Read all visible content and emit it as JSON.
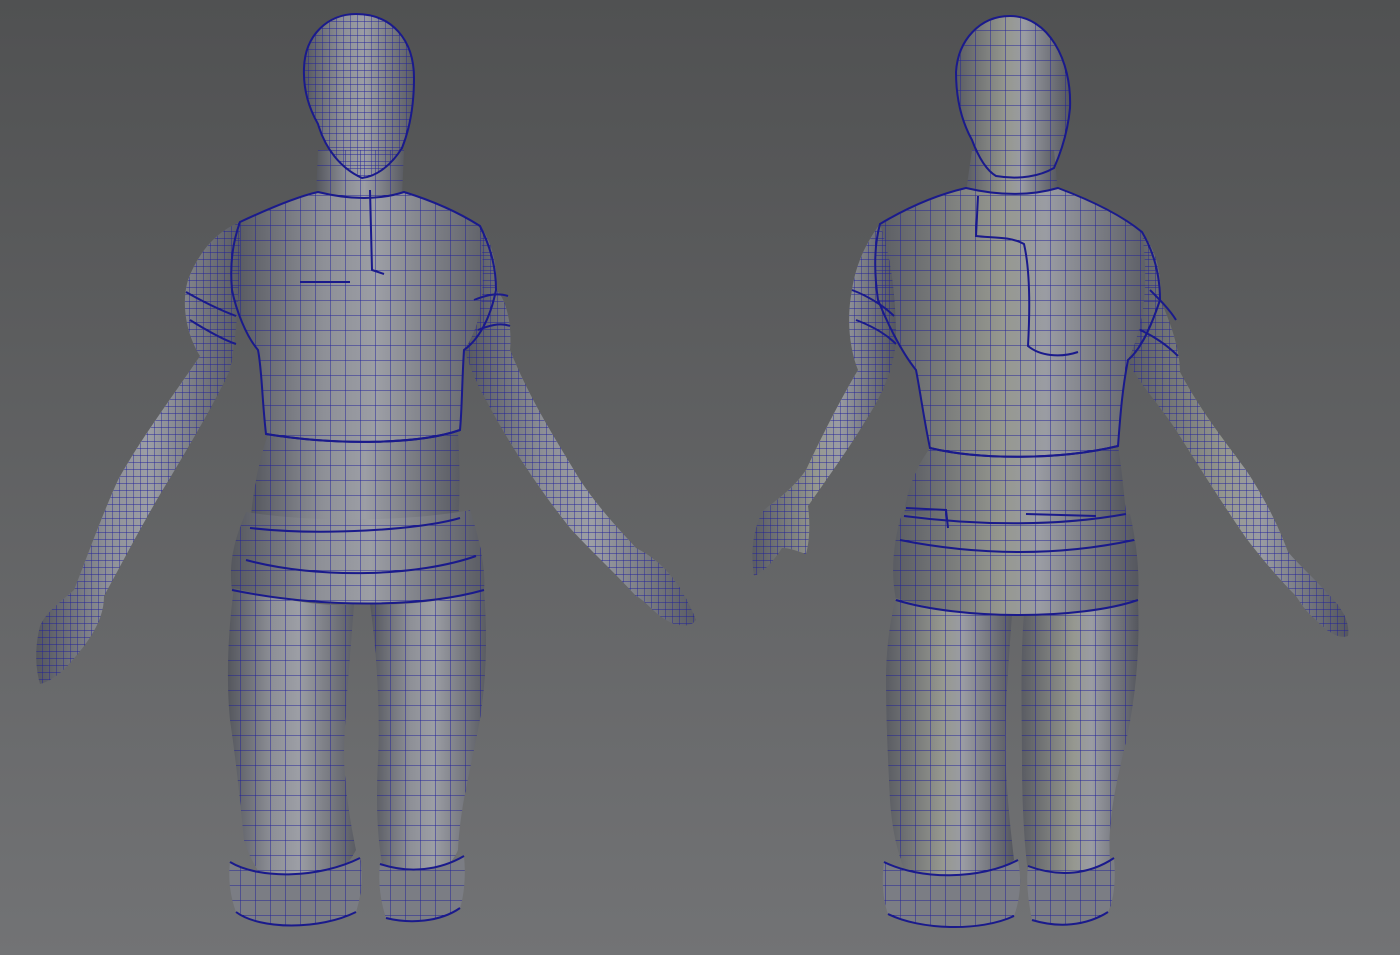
{
  "viewport": {
    "background_top": "#505152",
    "background_bottom": "#727375"
  },
  "models": [
    {
      "id": "front",
      "view": "front",
      "name_icon": "character-front-view"
    },
    {
      "id": "back",
      "view": "back",
      "name_icon": "character-back-view"
    }
  ],
  "colors": {
    "wire": "#1f1f9a",
    "surface_light": "#9a9ca3",
    "surface_mid": "#7b7d84",
    "surface_dark": "#4e5057"
  }
}
